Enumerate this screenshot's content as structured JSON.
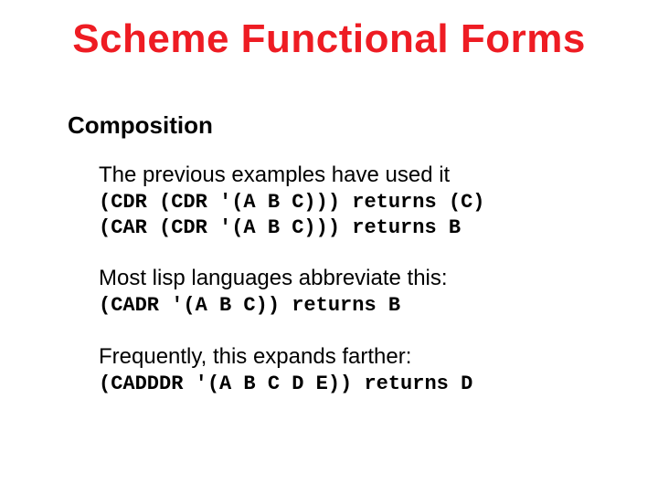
{
  "title": "Scheme Functional Forms",
  "section": "Composition",
  "blocks": [
    {
      "lead": "The previous examples have used it",
      "code": [
        "(CDR (CDR '(A B C))) returns (C)",
        "(CAR (CDR '(A B C))) returns B"
      ]
    },
    {
      "lead": "Most lisp languages abbreviate this:",
      "code": [
        "(CADR '(A B C)) returns B"
      ]
    },
    {
      "lead": "Frequently, this expands farther:",
      "code": [
        "(CADDDR '(A B C D E)) returns D"
      ]
    }
  ]
}
